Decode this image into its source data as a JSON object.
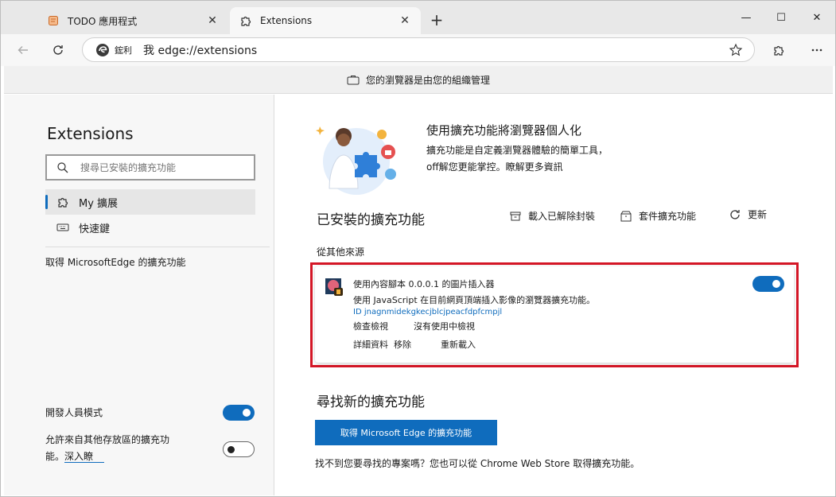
{
  "tabs": [
    {
      "label": "TODO 應用程式",
      "close": "✕"
    },
    {
      "label": "Extensions",
      "close": "✕"
    }
  ],
  "new_tab": "+",
  "window_controls": {
    "minimize": "—",
    "maximize": "☐",
    "close": "✕"
  },
  "toolbar": {
    "site_name": "鋐利",
    "url_prefix": "我",
    "url": "edge://extensions"
  },
  "managed_bar": {
    "text": "您的瀏覽器是由您的組織管理"
  },
  "sidebar": {
    "title": "Extensions",
    "search_placeholder": "搜尋已安裝的擴充功能",
    "nav": [
      {
        "label": "My 擴展"
      },
      {
        "label": "快速鍵"
      }
    ],
    "get_link": "取得 MicrosoftEdge 的擴充功能",
    "developer_mode": {
      "label": "開發人員模式",
      "enabled": true
    },
    "allow_other_stores": {
      "label": "允許來自其他存放區的擴充功能。",
      "learn_more": "深入瞭",
      "enabled": false
    }
  },
  "main": {
    "hero_title": "使用擴充功能將瀏覽器個人化",
    "hero_line1": "擴充功能是自定義瀏覽器體驗的簡單工具，",
    "hero_line2": "off解您更能掌控。瞭解更多資訊",
    "installed_title": "已安裝的擴充功能",
    "actions": {
      "load_unpacked": "載入已解除封裝",
      "pack": "套件擴充功能",
      "update": "更新"
    },
    "from_other_sources": "從其他來源",
    "extension": {
      "name": "使用內容腳本 0.0.0.1 的圖片插入器",
      "description": "使用 JavaScript 在目前網頁頂端插入影像的瀏覽器擴充功能。",
      "id": "ID jnagnmidekgkecjblcjpeacfdpfcmpjl",
      "inspect": "檢查檢視",
      "inactive": "沒有使用中檢視",
      "details": "詳細資料",
      "remove": "移除",
      "reload": "重新載入",
      "enabled": true
    },
    "find_title": "尋找新的擴充功能",
    "get_button": "取得 Microsoft Edge 的擴充功能",
    "cant_find": "找不到您要尋找的專案嗎？您也可以從 Chrome Web Store 取得擴充功能。"
  },
  "colors": {
    "accent": "#0f6cbd",
    "highlight": "#d41626"
  }
}
